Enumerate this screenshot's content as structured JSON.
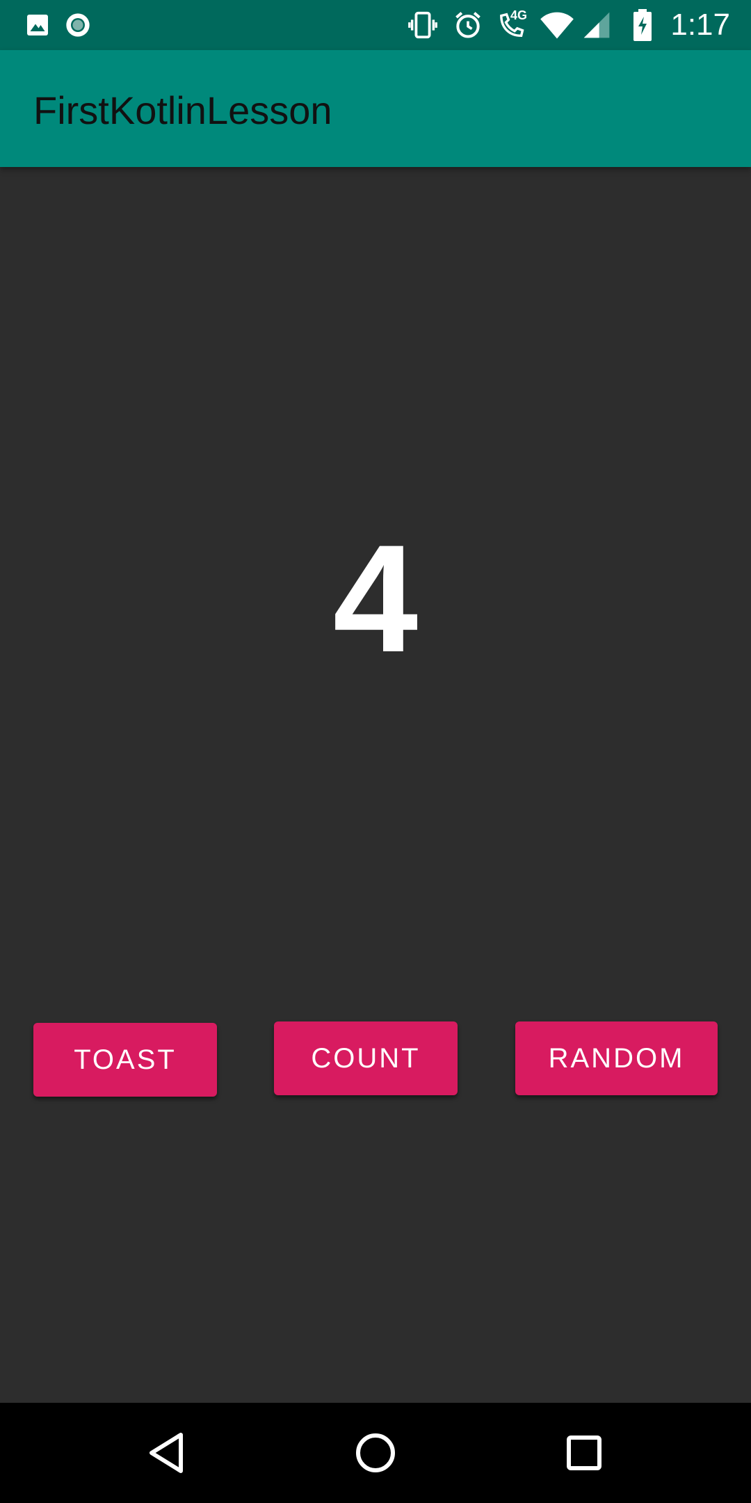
{
  "status_bar": {
    "time": "1:17",
    "left_icons": [
      "image-icon",
      "record-icon"
    ],
    "right_icons": [
      "vibrate-icon",
      "alarm-icon",
      "call-4g-icon",
      "wifi-icon",
      "signal-icon",
      "battery-charging-icon"
    ],
    "network_label": "4G",
    "background": "#00695c"
  },
  "app_bar": {
    "title": "FirstKotlinLesson",
    "background": "#00897b"
  },
  "main": {
    "count_value": "4",
    "background": "#2d2d2d"
  },
  "buttons": {
    "toast_label": "TOAST",
    "count_label": "COUNT",
    "random_label": "RANDOM",
    "color": "#d81b60"
  },
  "nav_bar": {
    "icons": [
      "back-icon",
      "home-icon",
      "recents-icon"
    ]
  }
}
